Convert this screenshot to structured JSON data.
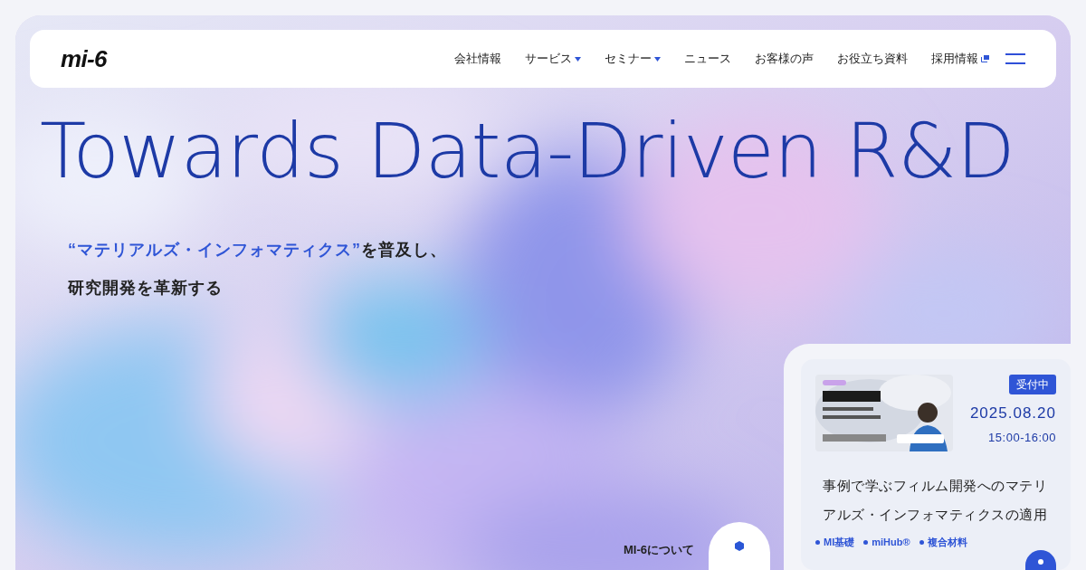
{
  "header": {
    "logo": "mi-6",
    "nav": [
      {
        "label": "会社情報",
        "kind": "plain"
      },
      {
        "label": "サービス",
        "kind": "dropdown"
      },
      {
        "label": "セミナー",
        "kind": "dropdown"
      },
      {
        "label": "ニュース",
        "kind": "plain"
      },
      {
        "label": "お客様の声",
        "kind": "plain"
      },
      {
        "label": "お役立ち資料",
        "kind": "plain"
      },
      {
        "label": "採用情報",
        "kind": "external"
      }
    ]
  },
  "hero": {
    "headline": "Towards Data-Driven R&D",
    "tagline_highlight": "“マテリアルズ・インフォマティクス”",
    "tagline_rest": "を普及し、",
    "tagline_line2": "研究開発を革新する",
    "about_link": "MI-6について"
  },
  "seminar_card": {
    "status": "受付中",
    "date": "2025.08.20",
    "time": "15:00-16:00",
    "title": "事例で学ぶフィルム開発へのマテリアルズ・インフォマティクスの適用",
    "tags": [
      "MI基礎",
      "miHub®",
      "複合材料"
    ]
  }
}
